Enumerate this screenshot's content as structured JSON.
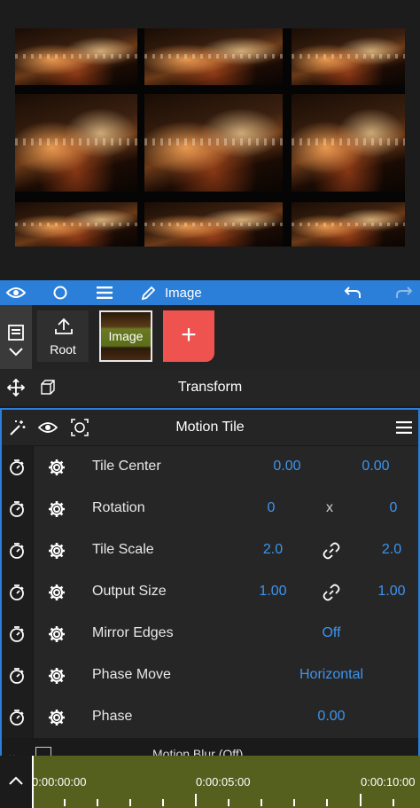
{
  "toolbar": {
    "title": "Image",
    "icons": [
      "eye-icon",
      "circle-icon",
      "menu-icon",
      "pencil-icon",
      "undo-icon",
      "redo-icon"
    ]
  },
  "layers": {
    "root_label": "Root",
    "image_label": "Image",
    "add_label": "+"
  },
  "transform": {
    "title": "Transform"
  },
  "effect": {
    "title": "Motion Tile",
    "params": [
      {
        "name": "Tile Center",
        "v1": "0.00",
        "sep": "",
        "v2": "0.00"
      },
      {
        "name": "Rotation",
        "v1": "0",
        "sep": "x",
        "v2": "0"
      },
      {
        "name": "Tile Scale",
        "v1": "2.0",
        "sep": "link",
        "v2": "2.0"
      },
      {
        "name": "Output Size",
        "v1": "1.00",
        "sep": "link",
        "v2": "1.00"
      },
      {
        "name": "Mirror Edges",
        "value": "Off"
      },
      {
        "name": "Phase Move",
        "value": "Horizontal"
      },
      {
        "name": "Phase",
        "value": "0.00"
      }
    ],
    "next_section": "Motion Blur (Off)"
  },
  "timeline": {
    "times": [
      "0:00:00:00",
      "0:00:05:00",
      "0:00:10:00"
    ]
  },
  "colors": {
    "accent": "#2b7fd8",
    "value": "#3d95ef",
    "add": "#ef5350",
    "timeline": "#55601e"
  }
}
